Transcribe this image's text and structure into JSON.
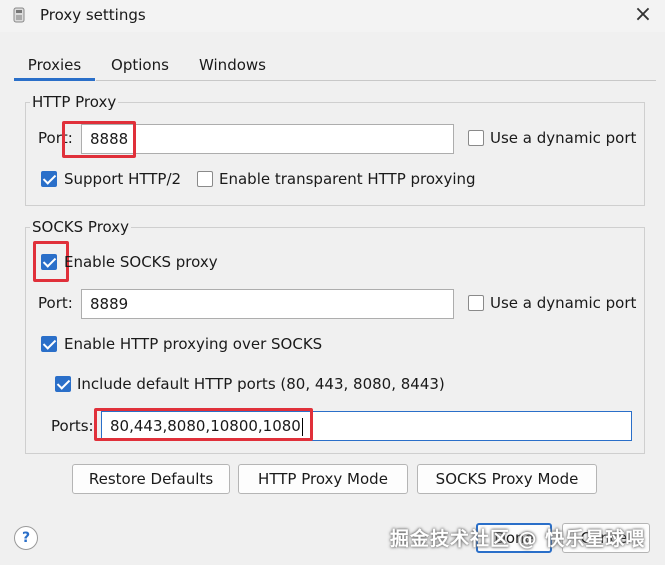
{
  "window": {
    "title": "Proxy settings",
    "close_icon": "×"
  },
  "tabs": [
    {
      "label": "Proxies",
      "active": true
    },
    {
      "label": "Options",
      "active": false
    },
    {
      "label": "Windows",
      "active": false
    }
  ],
  "http_proxy": {
    "group_title": "HTTP Proxy",
    "port_label": "Port:",
    "port_value": "8888",
    "dynamic_port_label": "Use a dynamic port",
    "dynamic_port_checked": false,
    "support_http2_label": "Support HTTP/2",
    "support_http2_checked": true,
    "transparent_label": "Enable transparent HTTP proxying",
    "transparent_checked": false
  },
  "socks_proxy": {
    "group_title": "SOCKS Proxy",
    "enable_label": "Enable SOCKS proxy",
    "enable_checked": true,
    "port_label": "Port:",
    "port_value": "8889",
    "dynamic_port_label": "Use a dynamic port",
    "dynamic_port_checked": false,
    "http_over_socks_label": "Enable HTTP proxying over SOCKS",
    "http_over_socks_checked": true,
    "include_default_label": "Include default HTTP ports (80, 443, 8080, 8443)",
    "include_default_checked": true,
    "ports_label": "Ports:",
    "ports_value": "80,443,8080,10800,1080"
  },
  "buttons": {
    "restore_defaults": "Restore Defaults",
    "http_proxy_mode": "HTTP Proxy Mode",
    "socks_proxy_mode": "SOCKS Proxy Mode",
    "done": "Done",
    "cancel": "Cancel",
    "help": "?"
  },
  "watermark": "掘金技术社区 @ 快乐星球喂",
  "colors": {
    "accent": "#2a6fc9",
    "highlight": "#e0303a",
    "background": "#f0f0f0"
  }
}
